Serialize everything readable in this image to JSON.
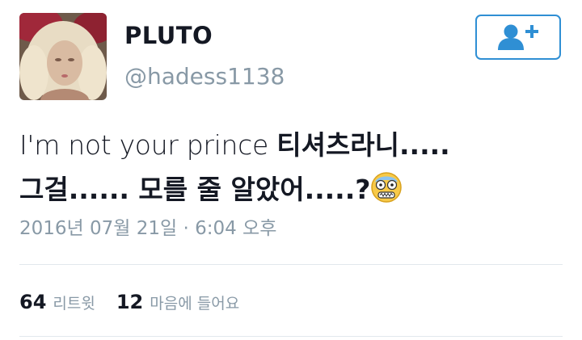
{
  "user": {
    "name": "PLUTO",
    "handle": "@hadess1138"
  },
  "tweet": {
    "line1_latin": "I'm not your prince ",
    "line1_hangul": "티셔츠라니.....",
    "line2_hangul": "그걸...... 모를 줄 알았어.....?",
    "emoji": "face-screaming-emoji",
    "timestamp": "2016년 07월 21일 · 6:04 오후"
  },
  "stats": {
    "retweets_count": "64",
    "retweets_label": "리트윗",
    "likes_count": "12",
    "likes_label": "마음에 들어요"
  },
  "colors": {
    "accent": "#2f8fd4",
    "muted_text": "#8899a6",
    "primary_text": "#141823",
    "divider": "#e1e8ed"
  },
  "icons": {
    "follow": "add-user-icon"
  }
}
